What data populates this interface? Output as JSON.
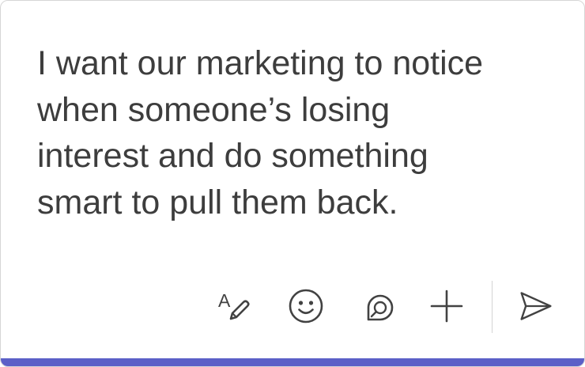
{
  "compose": {
    "message_text": "I want our marketing to notice\nwhen someone’s losing\ninterest and do something\nsmart to pull them back."
  },
  "toolbar": {
    "buttons": [
      {
        "name": "format",
        "icon": "format-text-pen-icon"
      },
      {
        "name": "emoji",
        "icon": "emoji-smile-icon"
      },
      {
        "name": "loop",
        "icon": "loop-component-icon"
      },
      {
        "name": "attach",
        "icon": "plus-icon"
      },
      {
        "name": "send",
        "icon": "send-icon"
      }
    ]
  },
  "colors": {
    "accent": "#5b5fc7",
    "text": "#3d3d3d",
    "icon": "#424242",
    "border": "#d6d6d6"
  }
}
